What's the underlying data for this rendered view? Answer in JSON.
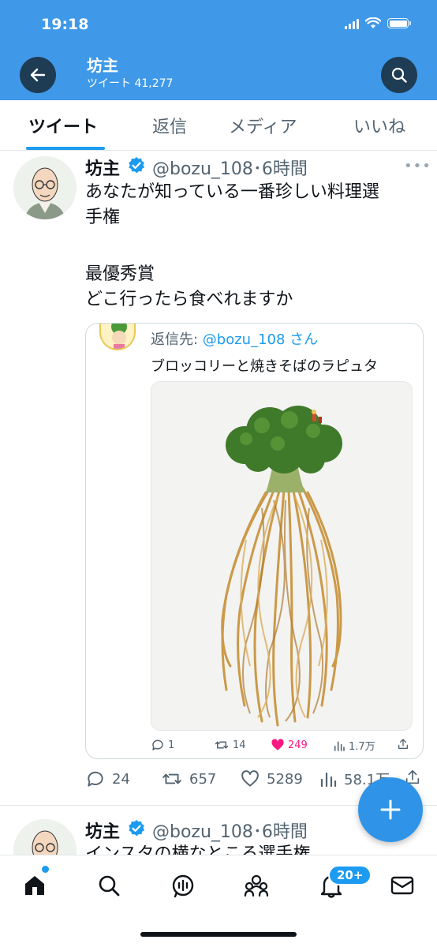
{
  "status_bar": {
    "time": "19:18"
  },
  "header": {
    "title": "坊主",
    "subtitle": "ツイート 41,277"
  },
  "tabs": [
    {
      "label": "ツイート",
      "active": true
    },
    {
      "label": "返信",
      "active": false
    },
    {
      "label": "メディア",
      "active": false
    },
    {
      "label": "いいね",
      "active": false
    }
  ],
  "tweets": [
    {
      "name": "坊主",
      "handle_time": "@bozu_108･6時間",
      "text_lines": [
        "あなたが知っている一番珍しい料理選",
        "手権",
        "",
        "最優秀賞",
        "どこ行ったら食べれますか"
      ],
      "quote": {
        "reply_prefix": "返信先: ",
        "reply_handle": "@bozu_108",
        "reply_suffix": " さん",
        "text": "ブロッコリーと焼きそばのラピュタ",
        "image": "broccoli-yakisoba-photo",
        "stats": {
          "replies": "1",
          "retweets": "14",
          "likes": "249",
          "views": "1.7万"
        }
      },
      "stats": {
        "replies": "24",
        "retweets": "657",
        "likes": "5289",
        "views": "58.1万"
      }
    },
    {
      "name": "坊主",
      "handle_time": "@bozu_108･6時間",
      "text_partial": "インスタの横なとこる選手権"
    }
  ],
  "bottom_nav": {
    "notifications_badge": "20+"
  },
  "colors": {
    "header_bg": "#3f99e8",
    "accent": "#1d9bf0",
    "like": "#f91880",
    "text": "#0f1419",
    "muted": "#536471"
  }
}
